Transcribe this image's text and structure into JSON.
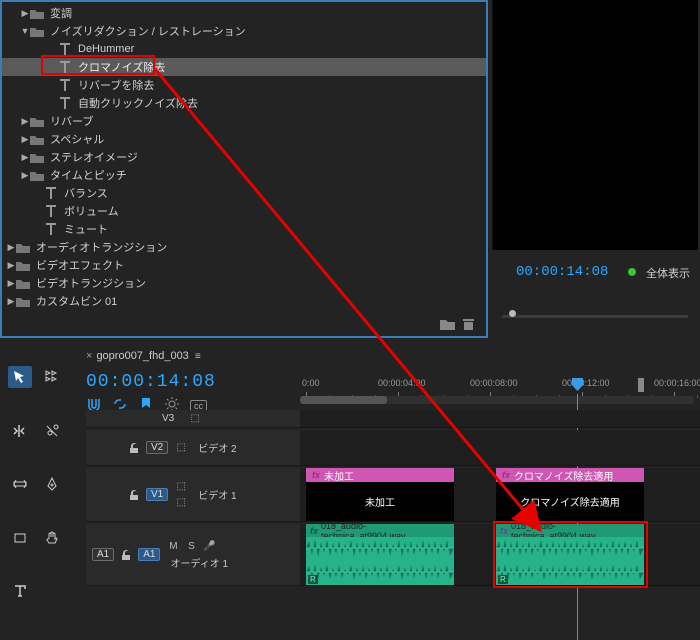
{
  "effects": {
    "tree": {
      "henchou": "変調",
      "noise_reduction": "ノイズリダクション / レストレーション",
      "dehummer": "DeHummer",
      "chroma_noise": "クロマノイズ除去",
      "reverb_remove": "リバーブを除去",
      "auto_click": "自動クリックノイズ除去",
      "reverb": "リバーブ",
      "special": "スペシャル",
      "stereo_image": "ステレオイメージ",
      "time_pitch": "タイムとピッチ",
      "balance": "バランス",
      "volume": "ボリューム",
      "mute": "ミュート",
      "audio_trans": "オーディオトランジション",
      "video_fx": "ビデオエフェクト",
      "video_trans": "ビデオトランジション",
      "custom_bin": "カスタムビン 01"
    }
  },
  "preview": {
    "timecode": "00:00:14:08",
    "display_mode": "全体表示"
  },
  "sequence": {
    "tab_name": "gopro007_fhd_003",
    "timecode": "00:00:14:08"
  },
  "ruler": {
    "t0": "0:00",
    "t1": "00:00:04:00",
    "t2": "00:00:08:00",
    "t3": "00:00:12:00",
    "t4": "00:00:16:00"
  },
  "tracks": {
    "v3": "V3",
    "v2": "V2",
    "v2_name": "ビデオ 2",
    "v1": "V1",
    "v1_name": "ビデオ 1",
    "a1_src": "A1",
    "a1": "A1",
    "a1_name": "オーディオ 1",
    "m": "M",
    "s": "S"
  },
  "clips": {
    "raw_hdr": "未加工",
    "raw_body": "未加工",
    "applied_hdr": "クロマノイズ除去適用",
    "applied_body": "クロマノイズ除去適用",
    "audio_name": "018_audio-technica_at9904.wav",
    "fx": "fx",
    "r": "R"
  }
}
